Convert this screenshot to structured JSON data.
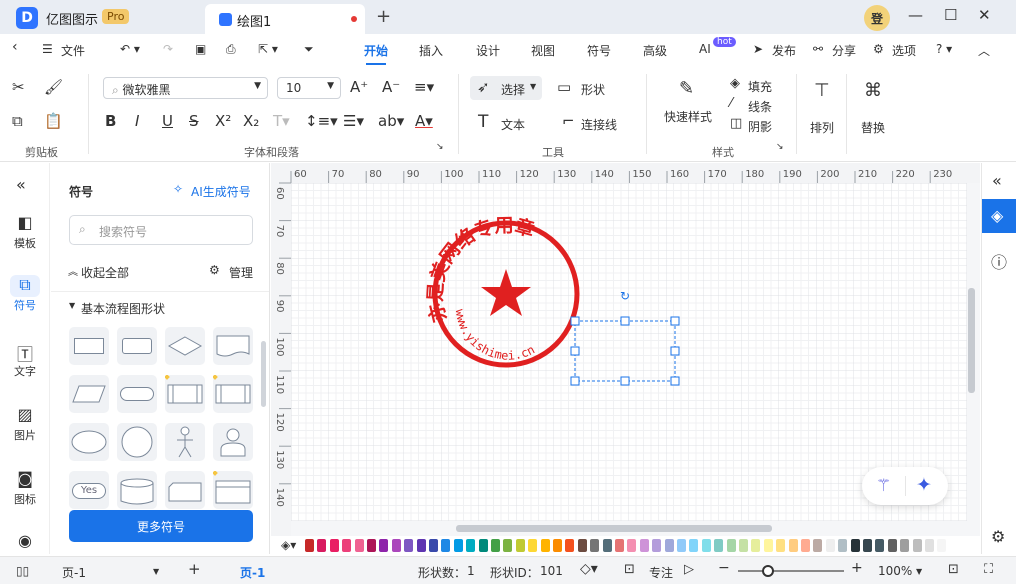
{
  "app": {
    "name": "亿图图示",
    "badge": "Pro",
    "doc_tab": "绘图1",
    "avatar": "登"
  },
  "menu": {
    "file": "文件",
    "tabs": [
      "开始",
      "插入",
      "设计",
      "视图",
      "符号",
      "高级",
      "AI"
    ],
    "hot": "hot",
    "publish": "发布",
    "share": "分享",
    "options": "选项"
  },
  "ribbon": {
    "font_name": "微软雅黑",
    "font_size": "10",
    "groups": {
      "clipboard": "剪贴板",
      "font": "字体和段落",
      "tools": "工具",
      "style": "样式"
    },
    "tools": {
      "select": "选择",
      "shape": "形状",
      "text": "文本",
      "connector": "连接线"
    },
    "style": {
      "quick": "快速样式",
      "fill": "填充",
      "line": "线条",
      "shadow": "阴影"
    },
    "arrange": "排列",
    "replace": "替换",
    "ab_label": "ab"
  },
  "leftnav": [
    "模板",
    "符号",
    "文字",
    "图片",
    "图标"
  ],
  "panel": {
    "title": "符号",
    "ai": "AI生成符号",
    "search_placeholder": "搜索符号",
    "collapse": "收起全部",
    "manage": "管理",
    "category": "基本流程图形状",
    "yes": "Yes",
    "more": "更多符号"
  },
  "ruler": {
    "h": [
      "60",
      "70",
      "80",
      "90",
      "100",
      "110",
      "120",
      "130",
      "140",
      "150",
      "160",
      "170",
      "180",
      "190",
      "200",
      "210",
      "220",
      "230"
    ],
    "v": [
      "60",
      "70",
      "80",
      "90",
      "100",
      "110",
      "120",
      "130",
      "140"
    ]
  },
  "stamp": {
    "text": "亦是美网络专用章",
    "url": "www.yishimei.cn"
  },
  "status": {
    "page_dropdown": "页-1",
    "page_tab": "页-1",
    "shape_count_label": "形状数：",
    "shape_count": "1",
    "shape_id_label": "形状ID：",
    "shape_id": "101",
    "focus": "专注",
    "zoom": "100%"
  },
  "colors": {
    "accent": "#1a73e8",
    "stamp": "#e02020",
    "palette": [
      "#c62828",
      "#d81b60",
      "#e91e63",
      "#ec407a",
      "#f06292",
      "#ad1457",
      "#8e24aa",
      "#ab47bc",
      "#7e57c2",
      "#5e35b1",
      "#3949ab",
      "#1e88e5",
      "#039be5",
      "#00acc1",
      "#00897b",
      "#43a047",
      "#7cb342",
      "#c0ca33",
      "#fdd835",
      "#ffb300",
      "#fb8c00",
      "#f4511e",
      "#6d4c41",
      "#757575",
      "#546e7a",
      "#e57373",
      "#f48fb1",
      "#ce93d8",
      "#b39ddb",
      "#9fa8da",
      "#90caf9",
      "#81d4fa",
      "#80deea",
      "#80cbc4",
      "#a5d6a7",
      "#c5e1a5",
      "#e6ee9c",
      "#fff59d",
      "#ffe082",
      "#ffcc80",
      "#ffab91",
      "#bcaaa4",
      "#eeeeee",
      "#b0bec5",
      "#263238",
      "#37474f",
      "#455a64",
      "#616161",
      "#9e9e9e",
      "#bdbdbd",
      "#e0e0e0",
      "#f5f5f5"
    ]
  }
}
